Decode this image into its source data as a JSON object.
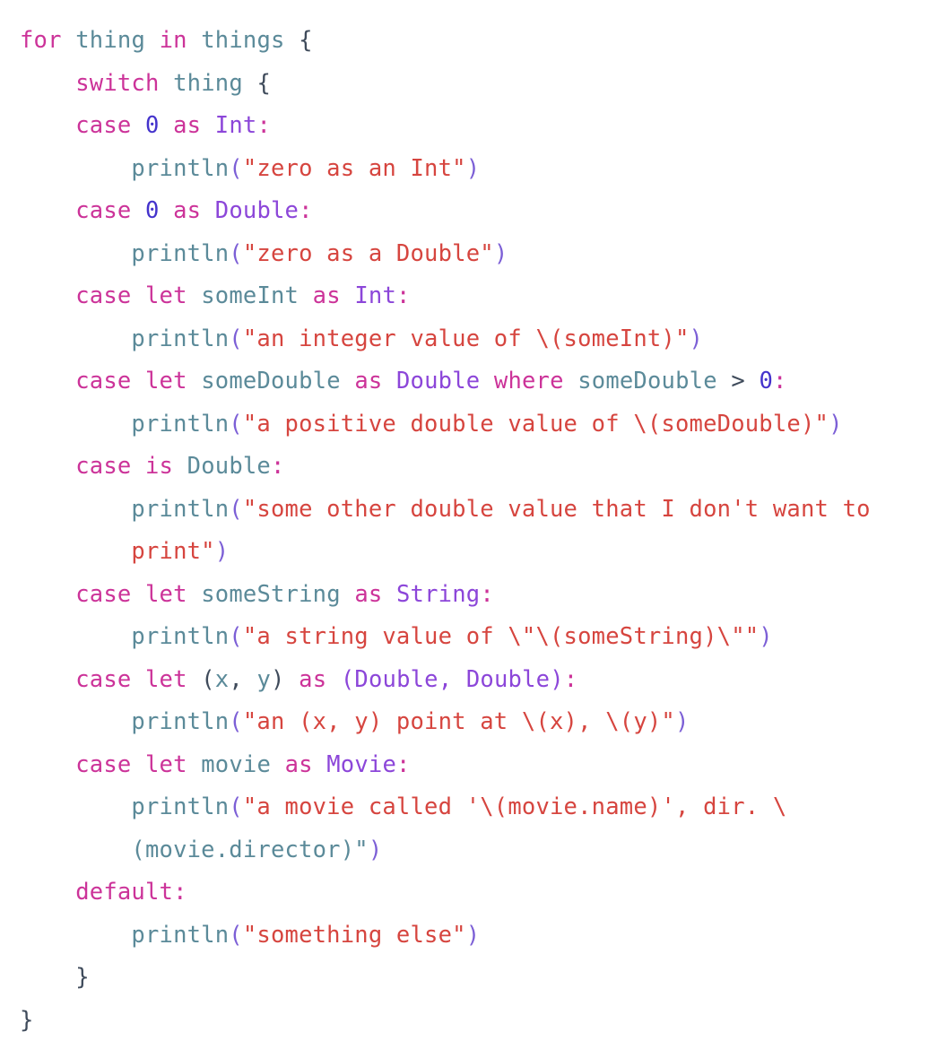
{
  "editor": {
    "language": "swift",
    "background": "#ffffff",
    "font_size_px": 25.5,
    "palette": {
      "keyword": "#cc3399",
      "type": "#8c46d9",
      "identifier": "#5b8a99",
      "number": "#4433cc",
      "string": "#d6453f",
      "punctuation": "#7c5fd6",
      "operator": "#3f4b5b",
      "brace": "#3f4b5b"
    }
  },
  "code": {
    "lines": [
      "for thing in things {",
      "    switch thing {",
      "    case 0 as Int:",
      "        println(\"zero as an Int\")",
      "    case 0 as Double:",
      "        println(\"zero as a Double\")",
      "    case let someInt as Int:",
      "        println(\"an integer value of \\(someInt)\")",
      "    case let someDouble as Double where someDouble > 0:",
      "        println(\"a positive double value of \\(someDouble)\")",
      "    case is Double:",
      "        println(\"some other double value that I don't want to",
      "        print\")",
      "    case let someString as String:",
      "        println(\"a string value of \\\"\\(someString)\\\"\")",
      "    case let (x, y) as (Double, Double):",
      "        println(\"an (x, y) point at \\(x), \\(y)\")",
      "    case let movie as Movie:",
      "        println(\"a movie called '\\(movie.name)', dir. \\",
      "        (movie.director)\")",
      "    default:",
      "        println(\"something else\")",
      "    }",
      "}"
    ],
    "line_01": "for thing in things {",
    "line_02": "    switch thing {",
    "line_03": "    case 0 as Int:",
    "line_04": "        println(\"zero as an Int\")",
    "line_05": "    case 0 as Double:",
    "line_06": "        println(\"zero as a Double\")",
    "line_07": "    case let someInt as Int:",
    "line_08": "        println(\"an integer value of \\(someInt)\")",
    "line_09": "    case let someDouble as Double where someDouble > 0:",
    "line_10": "        println(\"a positive double value of \\(someDouble)\")",
    "line_11": "    case is Double:",
    "line_12": "        println(\"some other double value that I don't want to",
    "line_13": "        print\")",
    "line_14": "    case let someString as String:",
    "line_15": "        println(\"a string value of \\\"\\(someString)\\\"\")",
    "line_16": "    case let (x, y) as (Double, Double):",
    "line_17": "        println(\"an (x, y) point at \\(x), \\(y)\")",
    "line_18": "    case let movie as Movie:",
    "line_19": "        println(\"a movie called '\\(movie.name)', dir. \\",
    "line_20": "        (movie.director)\")",
    "line_21": "    default:",
    "line_22": "        println(\"something else\")",
    "line_23": "    }",
    "line_24": "}"
  },
  "tokens": {
    "kw_for": "for",
    "kw_in": "in",
    "kw_switch": "switch",
    "kw_case": "case",
    "kw_let": "let",
    "kw_as": "as",
    "kw_where": "where",
    "kw_is": "is",
    "kw_default": "default:",
    "id_thing": "thing",
    "id_things": "things",
    "id_println": "println",
    "id_someInt": "someInt",
    "id_someDouble": "someDouble",
    "id_someString": "someString",
    "id_movie": "movie",
    "id_x": "x",
    "id_y": "y",
    "id_double_plain": "Double",
    "type_Int": "Int",
    "type_Double": "Double",
    "type_String": "String",
    "type_Movie": "Movie",
    "num_zero": "0",
    "op_gt": ">",
    "brace_open": "{",
    "brace_close": "}",
    "colon": ":",
    "paren_open": "(",
    "paren_close": ")",
    "str_zero_int": "\"zero as an Int\"",
    "str_zero_double": "\"zero as a Double\"",
    "str_integer_value": "\"an integer value of \\(someInt)\"",
    "str_positive_double": "\"a positive double value of \\(someDouble)\"",
    "str_some_other_1": "\"some other double value that I don't want to",
    "str_some_other_2": "print\"",
    "str_string_value": "\"a string value of \\\"\\(someString)\\\"\"",
    "str_point": "\"an (x, y) point at \\(x), \\(y)\"",
    "str_movie_1": "\"a movie called '\\(movie.name)', dir. \\",
    "str_movie_2": "(movie.director)\"",
    "str_something_else": "\"something else\""
  }
}
